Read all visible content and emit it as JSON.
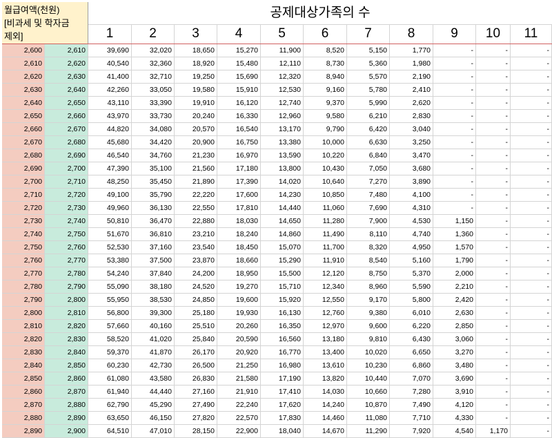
{
  "header": {
    "left_lines": [
      "월급여액(천원)",
      "[비과세 및 학자금",
      "제외]"
    ],
    "title": "공제대상가족의 수",
    "columns": [
      "1",
      "2",
      "3",
      "4",
      "5",
      "6",
      "7",
      "8",
      "9",
      "10",
      "11"
    ]
  },
  "rows": [
    [
      "2,600",
      "2,610",
      "39,690",
      "32,020",
      "18,650",
      "15,270",
      "11,900",
      "8,520",
      "5,150",
      "1,770",
      "-",
      "-",
      "-"
    ],
    [
      "2,610",
      "2,620",
      "40,540",
      "32,360",
      "18,920",
      "15,480",
      "12,110",
      "8,730",
      "5,360",
      "1,980",
      "-",
      "-",
      "-"
    ],
    [
      "2,620",
      "2,630",
      "41,400",
      "32,710",
      "19,250",
      "15,690",
      "12,320",
      "8,940",
      "5,570",
      "2,190",
      "-",
      "-",
      "-"
    ],
    [
      "2,630",
      "2,640",
      "42,260",
      "33,050",
      "19,580",
      "15,910",
      "12,530",
      "9,160",
      "5,780",
      "2,410",
      "-",
      "-",
      "-"
    ],
    [
      "2,640",
      "2,650",
      "43,110",
      "33,390",
      "19,910",
      "16,120",
      "12,740",
      "9,370",
      "5,990",
      "2,620",
      "-",
      "-",
      "-"
    ],
    [
      "2,650",
      "2,660",
      "43,970",
      "33,730",
      "20,240",
      "16,330",
      "12,960",
      "9,580",
      "6,210",
      "2,830",
      "-",
      "-",
      "-"
    ],
    [
      "2,660",
      "2,670",
      "44,820",
      "34,080",
      "20,570",
      "16,540",
      "13,170",
      "9,790",
      "6,420",
      "3,040",
      "-",
      "-",
      "-"
    ],
    [
      "2,670",
      "2,680",
      "45,680",
      "34,420",
      "20,900",
      "16,750",
      "13,380",
      "10,000",
      "6,630",
      "3,250",
      "-",
      "-",
      "-"
    ],
    [
      "2,680",
      "2,690",
      "46,540",
      "34,760",
      "21,230",
      "16,970",
      "13,590",
      "10,220",
      "6,840",
      "3,470",
      "-",
      "-",
      "-"
    ],
    [
      "2,690",
      "2,700",
      "47,390",
      "35,100",
      "21,560",
      "17,180",
      "13,800",
      "10,430",
      "7,050",
      "3,680",
      "-",
      "-",
      "-"
    ],
    [
      "2,700",
      "2,710",
      "48,250",
      "35,450",
      "21,890",
      "17,390",
      "14,020",
      "10,640",
      "7,270",
      "3,890",
      "-",
      "-",
      "-"
    ],
    [
      "2,710",
      "2,720",
      "49,100",
      "35,790",
      "22,220",
      "17,600",
      "14,230",
      "10,850",
      "7,480",
      "4,100",
      "-",
      "-",
      "-"
    ],
    [
      "2,720",
      "2,730",
      "49,960",
      "36,130",
      "22,550",
      "17,810",
      "14,440",
      "11,060",
      "7,690",
      "4,310",
      "-",
      "-",
      "-"
    ],
    [
      "2,730",
      "2,740",
      "50,810",
      "36,470",
      "22,880",
      "18,030",
      "14,650",
      "11,280",
      "7,900",
      "4,530",
      "1,150",
      "-",
      "-"
    ],
    [
      "2,740",
      "2,750",
      "51,670",
      "36,810",
      "23,210",
      "18,240",
      "14,860",
      "11,490",
      "8,110",
      "4,740",
      "1,360",
      "-",
      "-"
    ],
    [
      "2,750",
      "2,760",
      "52,530",
      "37,160",
      "23,540",
      "18,450",
      "15,070",
      "11,700",
      "8,320",
      "4,950",
      "1,570",
      "-",
      "-"
    ],
    [
      "2,760",
      "2,770",
      "53,380",
      "37,500",
      "23,870",
      "18,660",
      "15,290",
      "11,910",
      "8,540",
      "5,160",
      "1,790",
      "-",
      "-"
    ],
    [
      "2,770",
      "2,780",
      "54,240",
      "37,840",
      "24,200",
      "18,950",
      "15,500",
      "12,120",
      "8,750",
      "5,370",
      "2,000",
      "-",
      "-"
    ],
    [
      "2,780",
      "2,790",
      "55,090",
      "38,180",
      "24,520",
      "19,270",
      "15,710",
      "12,340",
      "8,960",
      "5,590",
      "2,210",
      "-",
      "-"
    ],
    [
      "2,790",
      "2,800",
      "55,950",
      "38,530",
      "24,850",
      "19,600",
      "15,920",
      "12,550",
      "9,170",
      "5,800",
      "2,420",
      "-",
      "-"
    ],
    [
      "2,800",
      "2,810",
      "56,800",
      "39,300",
      "25,180",
      "19,930",
      "16,130",
      "12,760",
      "9,380",
      "6,010",
      "2,630",
      "-",
      "-"
    ],
    [
      "2,810",
      "2,820",
      "57,660",
      "40,160",
      "25,510",
      "20,260",
      "16,350",
      "12,970",
      "9,600",
      "6,220",
      "2,850",
      "-",
      "-"
    ],
    [
      "2,820",
      "2,830",
      "58,520",
      "41,020",
      "25,840",
      "20,590",
      "16,560",
      "13,180",
      "9,810",
      "6,430",
      "3,060",
      "-",
      "-"
    ],
    [
      "2,830",
      "2,840",
      "59,370",
      "41,870",
      "26,170",
      "20,920",
      "16,770",
      "13,400",
      "10,020",
      "6,650",
      "3,270",
      "-",
      "-"
    ],
    [
      "2,840",
      "2,850",
      "60,230",
      "42,730",
      "26,500",
      "21,250",
      "16,980",
      "13,610",
      "10,230",
      "6,860",
      "3,480",
      "-",
      "-"
    ],
    [
      "2,850",
      "2,860",
      "61,080",
      "43,580",
      "26,830",
      "21,580",
      "17,190",
      "13,820",
      "10,440",
      "7,070",
      "3,690",
      "-",
      "-"
    ],
    [
      "2,860",
      "2,870",
      "61,940",
      "44,440",
      "27,160",
      "21,910",
      "17,410",
      "14,030",
      "10,660",
      "7,280",
      "3,910",
      "-",
      "-"
    ],
    [
      "2,870",
      "2,880",
      "62,790",
      "45,290",
      "27,490",
      "22,240",
      "17,620",
      "14,240",
      "10,870",
      "7,490",
      "4,120",
      "-",
      "-"
    ],
    [
      "2,880",
      "2,890",
      "63,650",
      "46,150",
      "27,820",
      "22,570",
      "17,830",
      "14,460",
      "11,080",
      "7,710",
      "4,330",
      "-",
      "-"
    ],
    [
      "2,890",
      "2,900",
      "64,510",
      "47,010",
      "28,150",
      "22,900",
      "18,040",
      "14,670",
      "11,290",
      "7,920",
      "4,540",
      "1,170",
      "-"
    ]
  ]
}
